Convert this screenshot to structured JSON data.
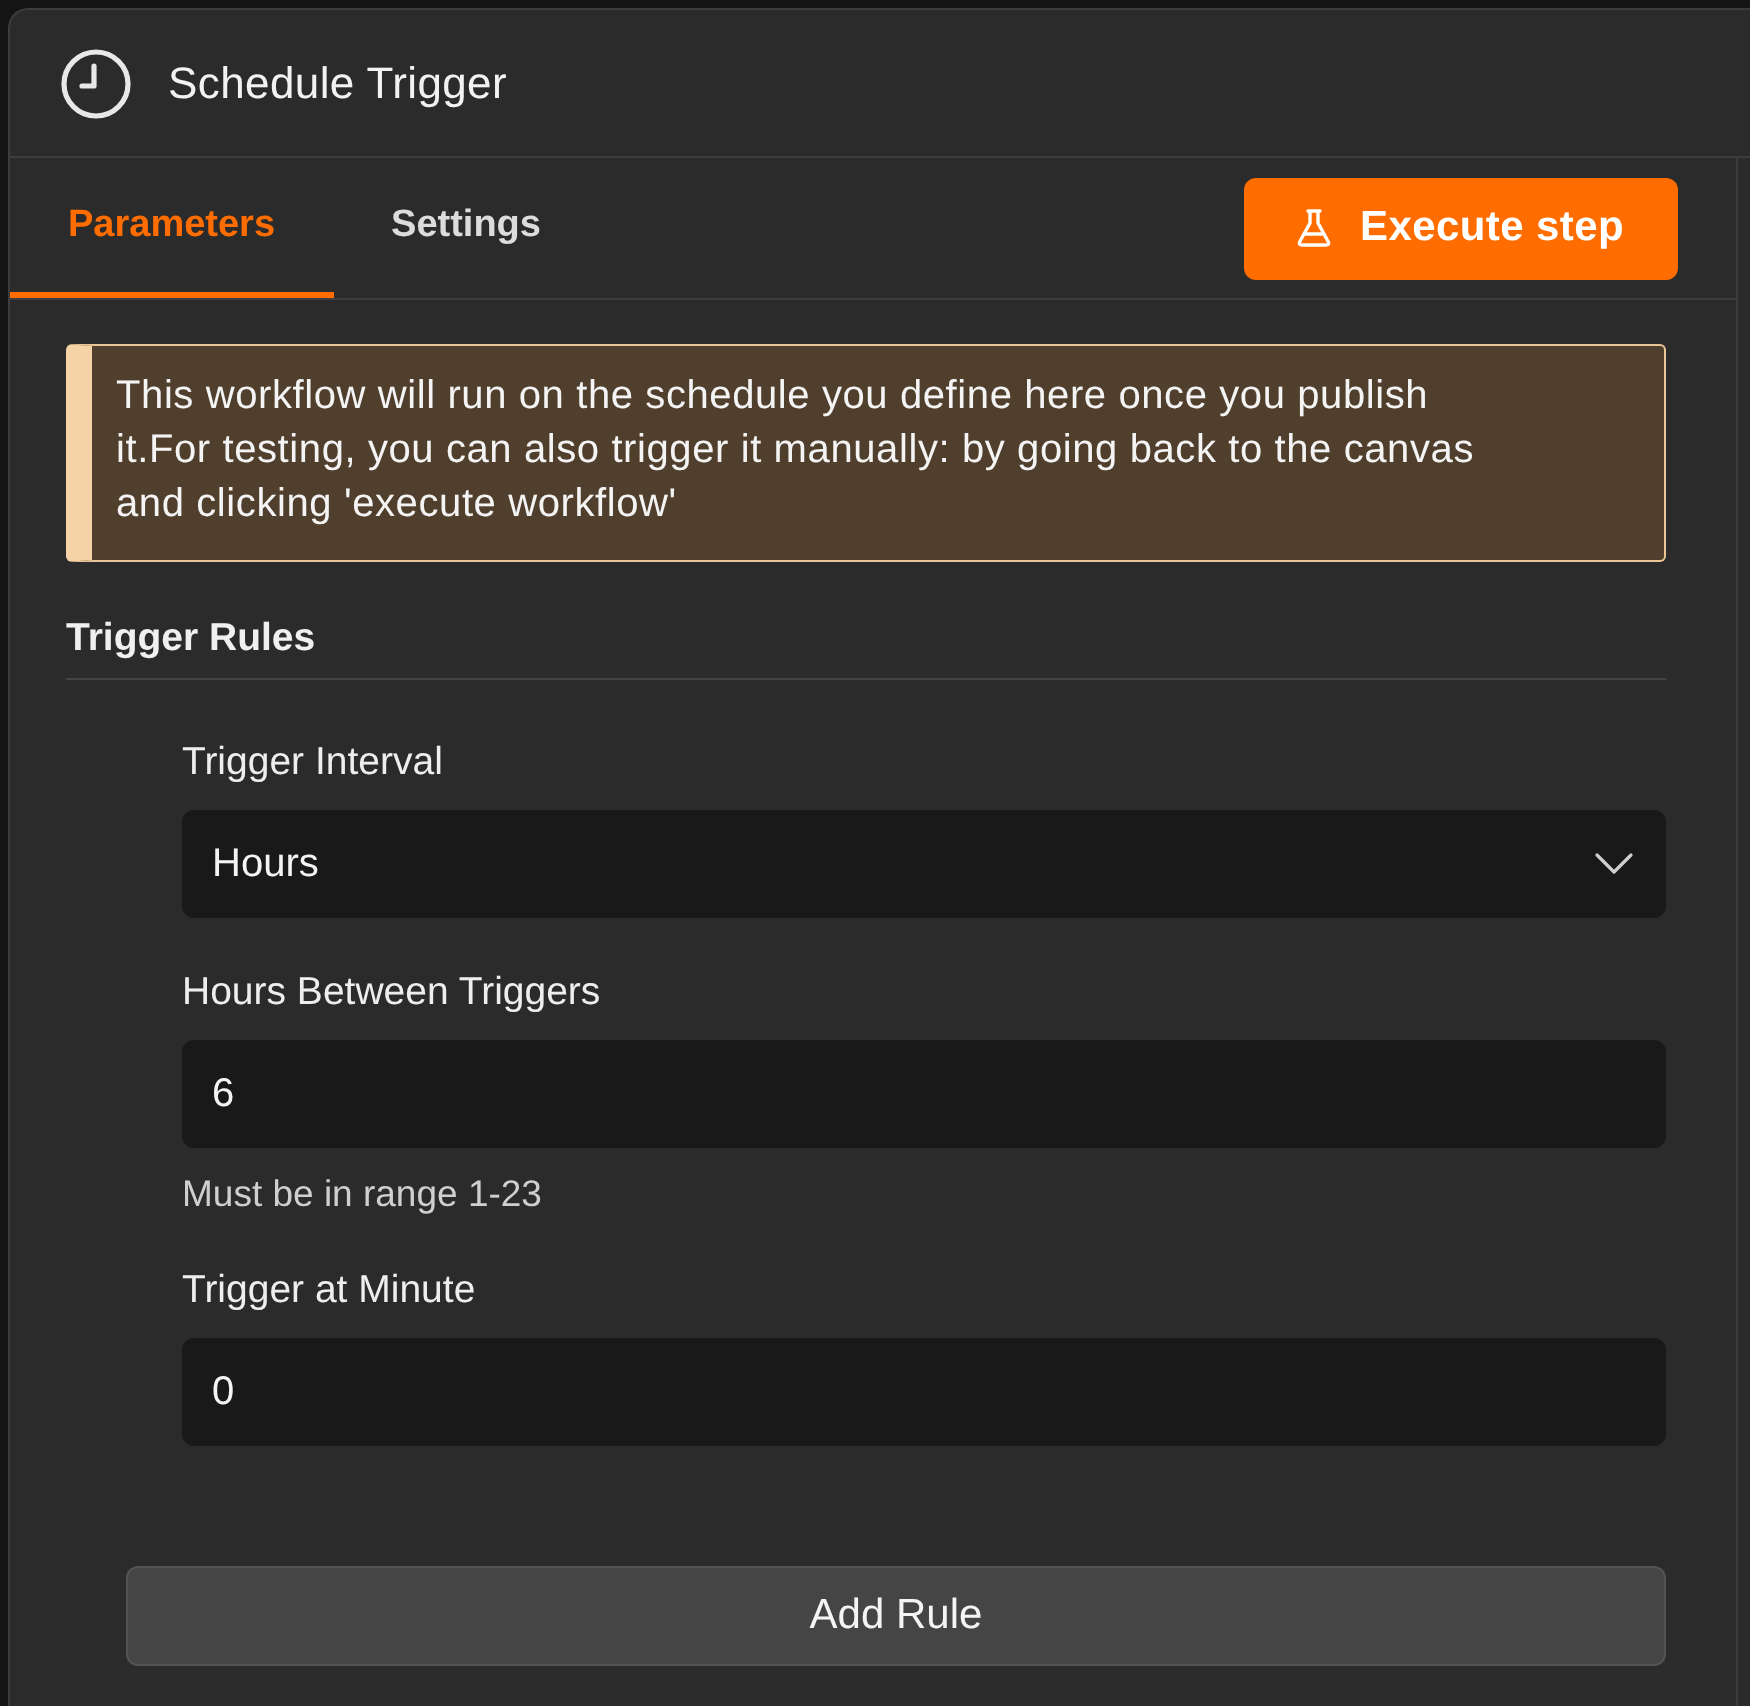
{
  "header": {
    "title": "Schedule Trigger"
  },
  "tabs": [
    {
      "label": "Parameters",
      "selected": true
    },
    {
      "label": "Settings",
      "selected": false
    }
  ],
  "execute_button": {
    "label": "Execute step"
  },
  "callout": {
    "text": "This workflow will run on the schedule you define here once you publish it.For testing, you can also trigger it manually: by going back to the canvas and clicking 'execute workflow'"
  },
  "section": {
    "title": "Trigger Rules"
  },
  "fields": [
    {
      "kind": "select",
      "label": "Trigger Interval",
      "value": "Hours"
    },
    {
      "kind": "input",
      "label": "Hours Between Triggers",
      "value": "6",
      "hint": "Must be in range 1-23"
    },
    {
      "kind": "input",
      "label": "Trigger at Minute",
      "value": "0"
    }
  ],
  "add_button": {
    "label": "Add Rule"
  }
}
